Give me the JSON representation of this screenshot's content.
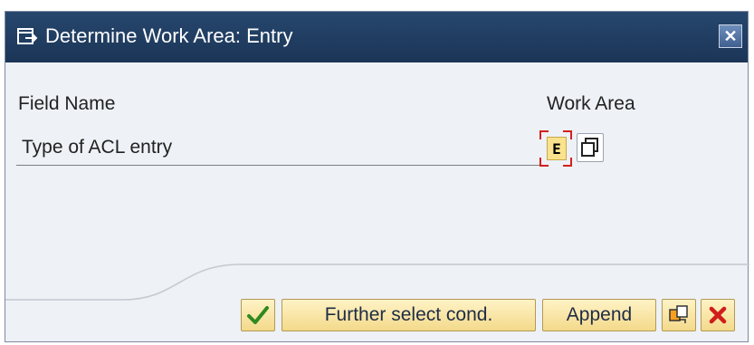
{
  "dialog": {
    "title": "Determine Work Area: Entry",
    "title_icon": "dialog-window-icon",
    "close_icon": "close-icon"
  },
  "table": {
    "header_field": "Field Name",
    "header_work_area": "Work Area",
    "rows": [
      {
        "field_name": "Type of ACL entry",
        "work_area": "E"
      }
    ]
  },
  "toolbar": {
    "confirm_icon": "checkmark-icon",
    "further_select_label": "Further select cond.",
    "append_label": "Append",
    "multiple_icon": "multiple-selection-icon",
    "cancel_icon": "cancel-icon"
  },
  "colors": {
    "titlebar": "#1f3a5f",
    "button_face": "#f3d98a",
    "input_highlight": "#fbe38e",
    "focus_bracket": "#d42020"
  }
}
